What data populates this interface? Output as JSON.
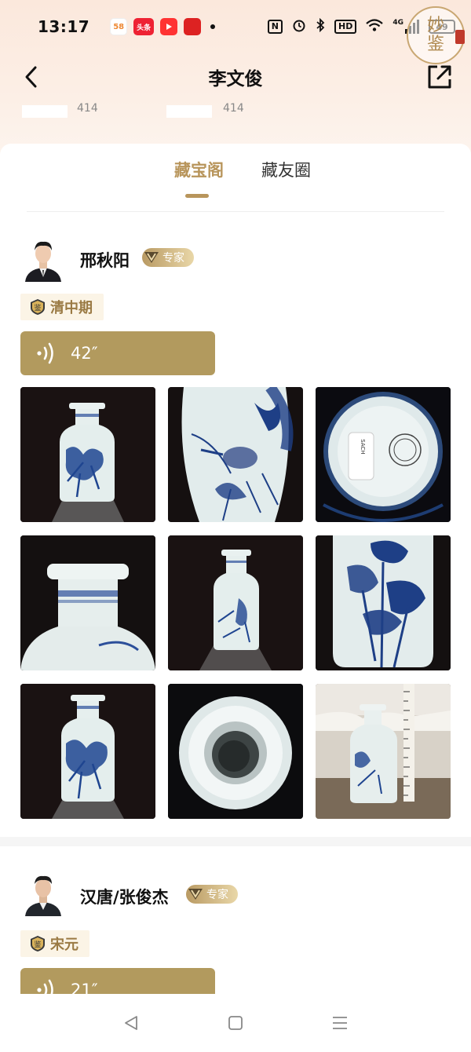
{
  "status_bar": {
    "time": "13:17",
    "app_icons": [
      "58",
      "头条",
      "",
      ""
    ],
    "network": "4G",
    "hd": "HD",
    "battery": "49"
  },
  "stamp": {
    "line1": "妙",
    "line2": "鉴"
  },
  "header": {
    "title": "李文俊",
    "stat1": "414",
    "stat2": "414"
  },
  "tabs": [
    {
      "label": "藏宝阁",
      "active": true
    },
    {
      "label": "藏友圈",
      "active": false
    }
  ],
  "posts": [
    {
      "author": "邢秋阳",
      "badge": "专家",
      "era": "清中期",
      "voice_duration": "42″",
      "photos": [
        "vase-front",
        "vase-detail-bird",
        "vase-base-mark",
        "vase-neck-closeup",
        "vase-side",
        "vase-lotus-detail",
        "vase-front-2",
        "vase-mouth-top",
        "vase-with-ruler"
      ]
    },
    {
      "author": "汉唐/张俊杰",
      "badge": "专家",
      "era": "宋元",
      "voice_duration": "21″"
    }
  ],
  "base_label": {
    "line1": "SACH",
    "line2": "CUSTOMS",
    "line3": "PERMISSION"
  },
  "colors": {
    "accent": "#b8955b",
    "voice_bar": "#b29a5e",
    "era_bg": "#fbf4e6",
    "era_text": "#9a7a44"
  }
}
